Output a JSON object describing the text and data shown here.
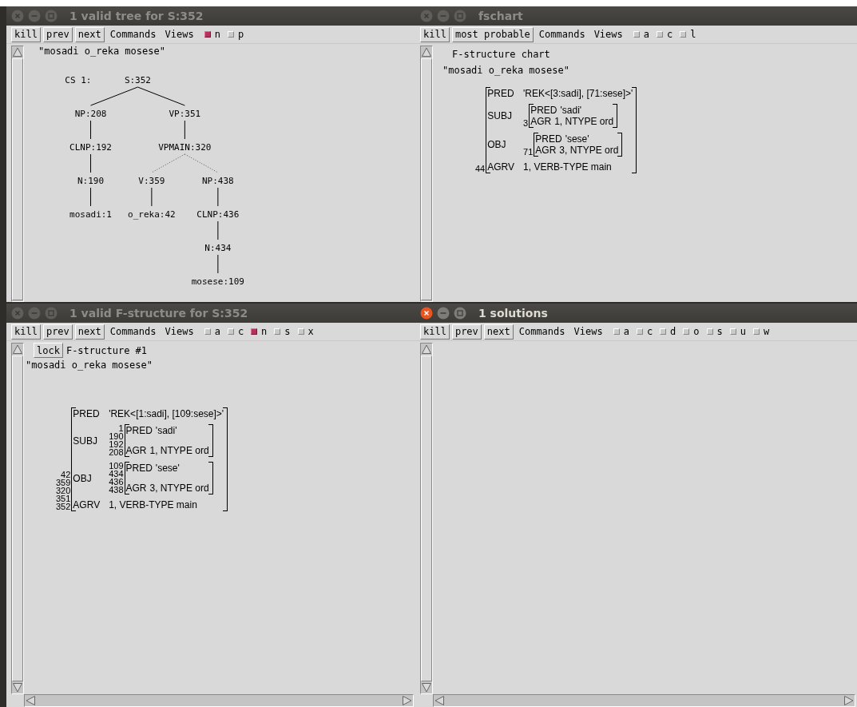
{
  "windows": [
    {
      "title": "1 valid tree for S:352",
      "active": false,
      "buttons": [
        "kill",
        "prev",
        "next"
      ],
      "menus": [
        "Commands",
        "Views"
      ],
      "toggles": [
        {
          "label": "n",
          "checked": true
        },
        {
          "label": "p",
          "checked": false
        }
      ],
      "content": {
        "kind": "tree",
        "sentence": "\"mosadi o_reka mosese\"",
        "prefix": "CS 1:",
        "tree": {
          "label": "S:352",
          "children": [
            {
              "label": "NP:208",
              "children": [
                {
                  "label": "CLNP:192",
                  "children": [
                    {
                      "label": "N:190",
                      "children": [
                        {
                          "label": "mosadi:1"
                        }
                      ]
                    }
                  ]
                }
              ]
            },
            {
              "label": "VP:351",
              "children": [
                {
                  "label": "VPMAIN:320",
                  "dotted": true,
                  "children": [
                    {
                      "label": "V:359",
                      "children": [
                        {
                          "label": "o_reka:42"
                        }
                      ]
                    },
                    {
                      "label": "NP:438",
                      "children": [
                        {
                          "label": "CLNP:436",
                          "children": [
                            {
                              "label": "N:434",
                              "children": [
                                {
                                  "label": "mosese:109"
                                }
                              ]
                            }
                          ]
                        }
                      ]
                    }
                  ]
                }
              ]
            }
          ]
        }
      }
    },
    {
      "title": "fschart",
      "active": false,
      "buttons": [
        "kill",
        "most probable"
      ],
      "menus": [
        "Commands",
        "Views"
      ],
      "toggles": [
        {
          "label": "a",
          "checked": false
        },
        {
          "label": "c",
          "checked": false
        },
        {
          "label": "l",
          "checked": false
        }
      ],
      "content": {
        "kind": "fschart",
        "heading": "F-structure chart",
        "sentence": "\"mosadi o_reka mosese\"",
        "fs": {
          "ids": [
            "44"
          ],
          "rows": [
            {
              "attr": "PRED",
              "value": "'REK<[3:sadi], [71:sese]>'"
            },
            {
              "attr": "SUBJ",
              "fs": {
                "ids": [
                  "3"
                ],
                "rows": [
                  {
                    "attr": "PRED",
                    "value": "'sadi'"
                  },
                  {
                    "attr": "AGR",
                    "value": "1, NTYPE ord"
                  }
                ]
              }
            },
            {
              "attr": "OBJ",
              "fs": {
                "ids": [
                  "71"
                ],
                "rows": [
                  {
                    "attr": "PRED",
                    "value": "'sese'"
                  },
                  {
                    "attr": "AGR",
                    "value": "3, NTYPE ord"
                  }
                ]
              }
            },
            {
              "attr": "AGRV",
              "value": "1, VERB-TYPE main"
            }
          ]
        }
      }
    },
    {
      "title": "1 valid F-structure for S:352",
      "active": false,
      "buttons": [
        "kill",
        "prev",
        "next"
      ],
      "menus": [
        "Commands",
        "Views"
      ],
      "toggles": [
        {
          "label": "a",
          "checked": false
        },
        {
          "label": "c",
          "checked": false
        },
        {
          "label": "n",
          "checked": true
        },
        {
          "label": "s",
          "checked": false
        },
        {
          "label": "x",
          "checked": false
        }
      ],
      "hscroll": true,
      "content": {
        "kind": "fstructure",
        "lock": "lock",
        "heading": "F-structure #1",
        "sentence": "\"mosadi o_reka mosese\"",
        "fs": {
          "ids": [
            "42",
            "359",
            "320",
            "351",
            "352"
          ],
          "rows": [
            {
              "attr": "PRED",
              "value": "'REK<[1:sadi], [109:sese]>'"
            },
            {
              "attr": "SUBJ",
              "fs": {
                "ids": [
                  "1",
                  "190",
                  "192",
                  "208"
                ],
                "rows": [
                  {
                    "attr": "PRED",
                    "value": "'sadi'"
                  },
                  {
                    "attr": "AGR",
                    "value": "1, NTYPE ord"
                  }
                ]
              }
            },
            {
              "attr": "OBJ",
              "fs": {
                "ids": [
                  "109",
                  "434",
                  "436",
                  "438"
                ],
                "rows": [
                  {
                    "attr": "PRED",
                    "value": "'sese'"
                  },
                  {
                    "attr": "AGR",
                    "value": "3, NTYPE ord"
                  }
                ]
              }
            },
            {
              "attr": "AGRV",
              "value": "1, VERB-TYPE main"
            }
          ]
        }
      }
    },
    {
      "title": "1 solutions",
      "active": true,
      "buttons": [
        "kill",
        "prev",
        "next"
      ],
      "menus": [
        "Commands",
        "Views"
      ],
      "toggles": [
        {
          "label": "a",
          "checked": false
        },
        {
          "label": "c",
          "checked": false
        },
        {
          "label": "d",
          "checked": false
        },
        {
          "label": "o",
          "checked": false
        },
        {
          "label": "s",
          "checked": false
        },
        {
          "label": "u",
          "checked": false
        },
        {
          "label": "w",
          "checked": false
        }
      ],
      "hscroll": true,
      "content": {
        "kind": "empty"
      }
    }
  ]
}
